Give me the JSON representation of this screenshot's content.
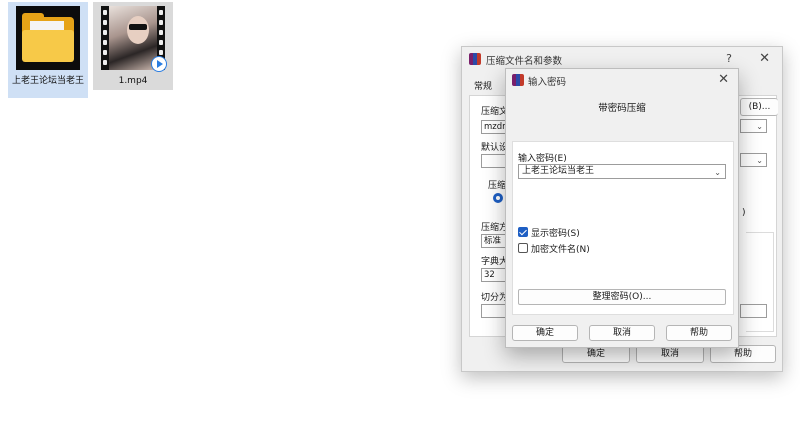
{
  "desktop": {
    "folder_label": "上老王论坛当老王",
    "video_label": "1.mp4"
  },
  "main_dialog": {
    "title": "压缩文件名和参数",
    "help": "?",
    "close": "✕",
    "tab_general": "常规",
    "frag_name": "压缩文",
    "frag_name_value": "mzdm",
    "frag_browse": "(B)...",
    "frag_default": "默认设",
    "frag_format": "压缩",
    "frag_method": "压缩方",
    "method_value": "标准",
    "frag_dict": "字典大",
    "dict_value": "32",
    "frag_split": "切分为",
    "frag_paren": ")",
    "ok": "确定",
    "cancel": "取消",
    "help_btn": "帮助"
  },
  "password_dialog": {
    "title": "输入密码",
    "close": "✕",
    "heading": "带密码压缩",
    "password_label": "输入密码(E)",
    "password_value": "上老王论坛当老王",
    "show_password": {
      "label": "显示密码(S)",
      "checked": true
    },
    "encrypt_names": {
      "label": "加密文件名(N)",
      "checked": false
    },
    "manage_button": "整理密码(O)...",
    "ok": "确定",
    "cancel": "取消",
    "help": "帮助"
  }
}
